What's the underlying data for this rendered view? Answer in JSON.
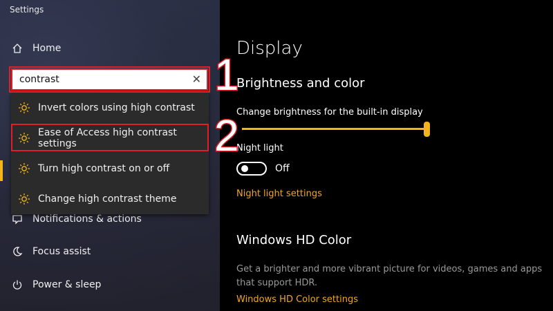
{
  "window": {
    "title": "Settings"
  },
  "sidebar": {
    "home_label": "Home",
    "items": [
      {
        "label": "Notifications & actions",
        "icon": "notifications-icon"
      },
      {
        "label": "Focus assist",
        "icon": "moon-icon"
      },
      {
        "label": "Power & sleep",
        "icon": "power-icon"
      }
    ]
  },
  "search": {
    "value": "contrast",
    "results": [
      {
        "label": "Invert colors using high contrast",
        "icon": "sun-icon"
      },
      {
        "label": "Ease of Access high contrast settings",
        "icon": "sun-icon"
      },
      {
        "label": "Turn high contrast on or off",
        "icon": "sun-icon"
      },
      {
        "label": "Change high contrast theme",
        "icon": "sun-icon"
      }
    ]
  },
  "annotations": {
    "step1": "1",
    "step2": "2"
  },
  "main": {
    "title": "Display",
    "brightness": {
      "heading": "Brightness and color",
      "slider_label": "Change brightness for the built-in display",
      "slider_value_percent": 100
    },
    "night_light": {
      "label": "Night light",
      "state": "Off",
      "settings_link": "Night light settings"
    },
    "hd_color": {
      "heading": "Windows HD Color",
      "description": "Get a brighter and more vibrant picture for videos, games and apps that support HDR.",
      "settings_link": "Windows HD Color settings"
    }
  },
  "colors": {
    "accent": "#f3b51b",
    "link": "#f3a81b",
    "annotation": "#e01f26"
  }
}
